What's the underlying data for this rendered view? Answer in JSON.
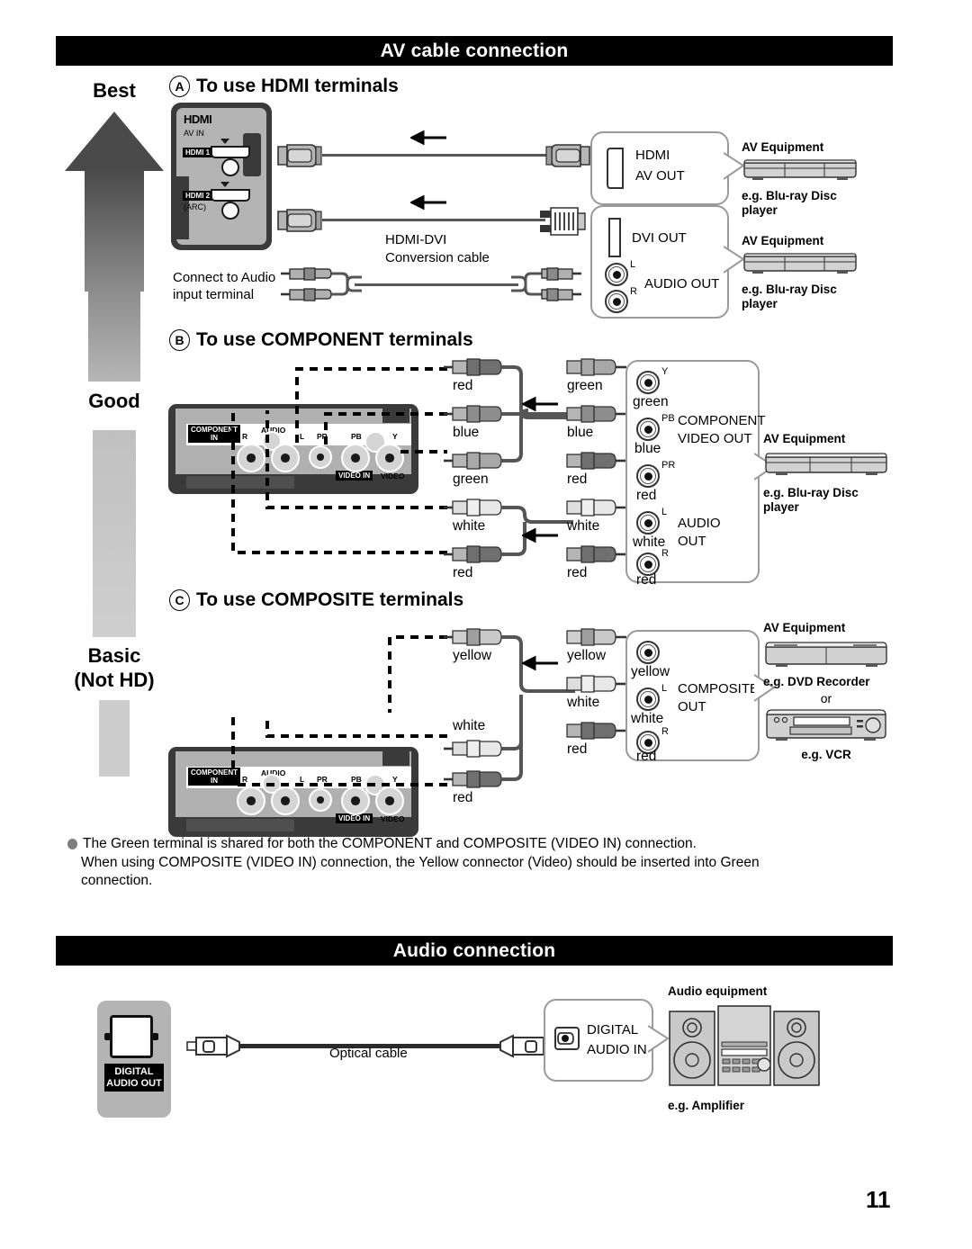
{
  "page": {
    "number": "11"
  },
  "sections": [
    {
      "id": "av",
      "title": "AV cable connection"
    },
    {
      "id": "audio",
      "title": "Audio connection"
    }
  ],
  "quality_scale": {
    "best": "Best",
    "good": "Good",
    "basic_line1": "Basic",
    "basic_line2": "(Not HD)"
  },
  "hdmi": {
    "mark": "A",
    "heading": "To use HDMI terminals",
    "tv_panel": {
      "logo": "HDMI",
      "av_in": "AV IN",
      "port1": "HDMI 1",
      "port2": "HDMI 2",
      "port2_sub": "(ARC)"
    },
    "cable2_label_line1": "HDMI-DVI",
    "cable2_label_line2": "Conversion cable",
    "audio_note_line1": "Connect to Audio",
    "audio_note_line2": "input terminal",
    "out_box_1": {
      "line1": "HDMI",
      "line2": "AV OUT"
    },
    "out_box_2": {
      "dvi": "DVI OUT",
      "audio": "AUDIO OUT",
      "l": "L",
      "r": "R"
    },
    "equipment_1": {
      "title": "AV Equipment",
      "caption_line1": "e.g. Blu-ray Disc",
      "caption_line2": "player"
    },
    "equipment_2": {
      "title": "AV Equipment",
      "caption_line1": "e.g. Blu-ray Disc",
      "caption_line2": "player"
    }
  },
  "component": {
    "mark": "B",
    "heading": "To use COMPONENT terminals",
    "tv_panel": {
      "component_in_line1": "COMPONENT",
      "component_in_line2": "IN",
      "audio": "AUDIO",
      "r": "R",
      "l": "L",
      "pr": "PR",
      "pb": "PB",
      "y": "Y",
      "video_in": "VIDEO IN",
      "video": "VIDEO"
    },
    "cable_left_labels": [
      "red",
      "blue",
      "green",
      "white",
      "red"
    ],
    "cable_right_labels": [
      "green",
      "blue",
      "red",
      "white",
      "red"
    ],
    "out_box": {
      "jacks": [
        {
          "top": "Y",
          "color": "green"
        },
        {
          "top": "PB",
          "color": "blue"
        },
        {
          "top": "PR",
          "color": "red"
        },
        {
          "top": "L",
          "color": "white"
        },
        {
          "top": "R",
          "color": "red"
        }
      ],
      "video_out_line1": "COMPONENT",
      "video_out_line2": "VIDEO OUT",
      "audio_out_line1": "AUDIO",
      "audio_out_line2": "OUT"
    },
    "equipment": {
      "title": "AV Equipment",
      "caption_line1": "e.g. Blu-ray Disc",
      "caption_line2": "player"
    }
  },
  "composite": {
    "mark": "C",
    "heading": "To use COMPOSITE terminals",
    "tv_panel": {
      "component_in_line1": "COMPONENT",
      "component_in_line2": "IN",
      "audio": "AUDIO",
      "r": "R",
      "l": "L",
      "pr": "PR",
      "pb": "PB",
      "y": "Y",
      "video_in": "VIDEO IN",
      "video": "VIDEO"
    },
    "cable_left_labels": [
      "yellow",
      "white",
      "red"
    ],
    "cable_right_labels": [
      "yellow",
      "white",
      "red"
    ],
    "out_box": {
      "jacks": [
        {
          "top": "",
          "color": "yellow"
        },
        {
          "top": "L",
          "color": "white"
        },
        {
          "top": "R",
          "color": "red"
        }
      ],
      "label_line1": "COMPOSITE",
      "label_line2": "OUT"
    },
    "equipment": {
      "title": "AV Equipment",
      "caption_1": "e.g. DVD Recorder",
      "or": "or",
      "caption_2": "e.g. VCR"
    }
  },
  "note": {
    "line1": "The Green terminal is shared for both the COMPONENT and COMPOSITE (VIDEO IN) connection.",
    "line2": "When using COMPOSITE (VIDEO IN) connection, the Yellow connector (Video) should be inserted into Green",
    "line3": "connection."
  },
  "audio_connection": {
    "tv_panel": {
      "label_line1": "DIGITAL",
      "label_line2": "AUDIO OUT"
    },
    "cable_label": "Optical cable",
    "in_box": {
      "line1": "DIGITAL",
      "line2": "AUDIO IN"
    },
    "equipment": {
      "title": "Audio equipment",
      "caption": "e.g. Amplifier"
    }
  },
  "colors": {
    "black": "#000000",
    "panel_dark": "#3a3a3a",
    "panel_face": "#b0b0b0",
    "callout_border": "#9a9a9a",
    "cable": "#555555",
    "red": "#6f6f6f",
    "blue": "#8d8d8d",
    "green": "#a8a8a8",
    "white": "#e8e8e8",
    "yellow": "#c9c9c9"
  }
}
